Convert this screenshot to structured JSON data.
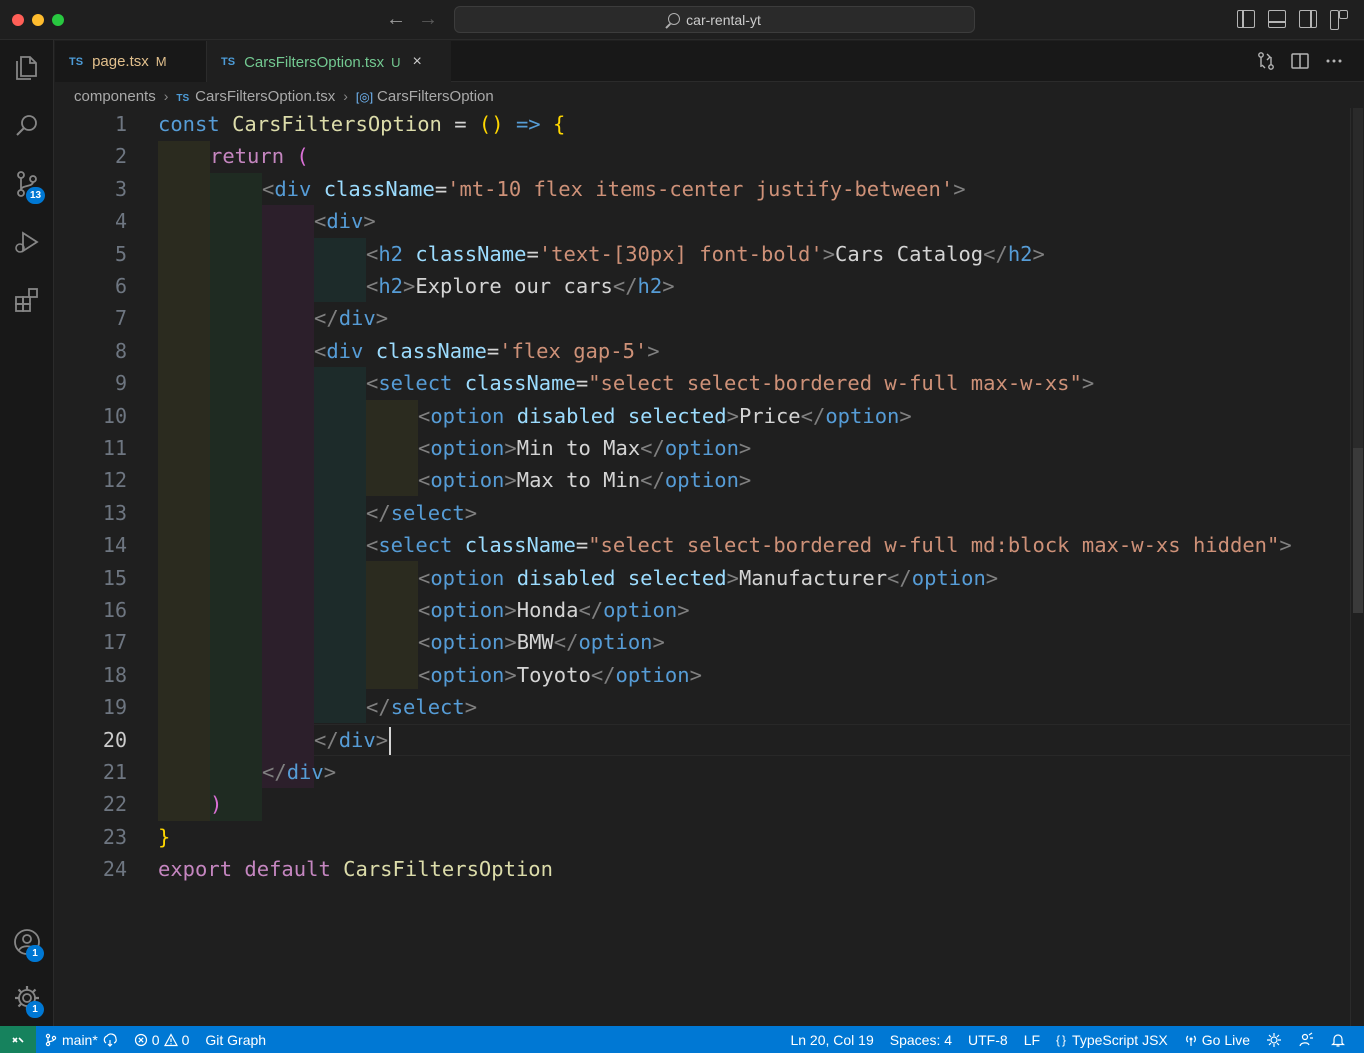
{
  "window": {
    "search_text": "car-rental-yt"
  },
  "activity_bar": {
    "source_control_badge": "13",
    "accounts_badge": "1",
    "manage_badge": "1"
  },
  "tabs": [
    {
      "type_label": "TS",
      "name": "page.tsx",
      "flag": "M"
    },
    {
      "type_label": "TS",
      "name": "CarsFiltersOption.tsx",
      "flag": "U",
      "close": "×"
    }
  ],
  "breadcrumbs": {
    "folder": "components",
    "file_type": "TS",
    "file": "CarsFiltersOption.tsx",
    "symbol": "CarsFiltersOption"
  },
  "editor": {
    "active_line": 20,
    "line_numbers": [
      "1",
      "2",
      "3",
      "4",
      "5",
      "6",
      "7",
      "8",
      "9",
      "10",
      "11",
      "12",
      "13",
      "14",
      "15",
      "16",
      "17",
      "18",
      "19",
      "20",
      "21",
      "22",
      "23",
      "24"
    ]
  },
  "code": {
    "l1": [
      "const",
      " ",
      "CarsFiltersOption",
      " ",
      "=",
      " ",
      "()",
      " ",
      "=>",
      " ",
      "{"
    ],
    "l2": [
      "return",
      " ",
      "("
    ],
    "l3": [
      "<",
      "div",
      " ",
      "className",
      "=",
      "'mt-10 flex items-center justify-between'",
      ">"
    ],
    "l4": [
      "<",
      "div",
      ">"
    ],
    "l5": [
      "<",
      "h2",
      " ",
      "className",
      "=",
      "'text-[30px] font-bold'",
      ">",
      "Cars Catalog",
      "</",
      "h2",
      ">"
    ],
    "l6": [
      "<",
      "h2",
      ">",
      "Explore our cars",
      "</",
      "h2",
      ">"
    ],
    "l7": [
      "</",
      "div",
      ">"
    ],
    "l8": [
      "<",
      "div",
      " ",
      "className",
      "=",
      "'flex gap-5'",
      ">"
    ],
    "l9": [
      "<",
      "select",
      " ",
      "className",
      "=",
      "\"select select-bordered w-full max-w-xs\"",
      ">"
    ],
    "l10": [
      "<",
      "option",
      " ",
      "disabled",
      " ",
      "selected",
      ">",
      "Price",
      "</",
      "option",
      ">"
    ],
    "l11": [
      "<",
      "option",
      ">",
      "Min to Max",
      "</",
      "option",
      ">"
    ],
    "l12": [
      "<",
      "option",
      ">",
      "Max to Min",
      "</",
      "option",
      ">"
    ],
    "l13": [
      "</",
      "select",
      ">"
    ],
    "l14": [
      "<",
      "select",
      " ",
      "className",
      "=",
      "\"select select-bordered w-full md:block max-w-xs hidden\"",
      ">"
    ],
    "l15": [
      "<",
      "option",
      " ",
      "disabled",
      " ",
      "selected",
      ">",
      "Manufacturer",
      "</",
      "option",
      ">"
    ],
    "l16": [
      "<",
      "option",
      ">",
      "Honda",
      "</",
      "option",
      ">"
    ],
    "l17": [
      "<",
      "option",
      ">",
      "BMW",
      "</",
      "option",
      ">"
    ],
    "l18": [
      "<",
      "option",
      ">",
      "Toyoto",
      "</",
      "option",
      ">"
    ],
    "l19": [
      "</",
      "select",
      ">"
    ],
    "l20": [
      "</",
      "div",
      ">"
    ],
    "l21": [
      "</",
      "div",
      ">"
    ],
    "l22": [
      ")"
    ],
    "l23": [
      "}"
    ],
    "l24": [
      "export",
      " ",
      "default",
      " ",
      "CarsFiltersOption"
    ]
  },
  "status_bar": {
    "branch": "main*",
    "errors": "0",
    "warnings": "0",
    "git_graph": "Git Graph",
    "cursor": "Ln 20, Col 19",
    "spaces": "Spaces: 4",
    "encoding": "UTF-8",
    "eol": "LF",
    "language_braces": "{}",
    "language": "TypeScript JSX",
    "go_live": "Go Live"
  },
  "colors": {
    "accent": "#0078d4",
    "remote": "#16825d",
    "editor_bg": "#1f1f1f",
    "guide_yellow": "#2c2c1f",
    "guide_green": "#1f2b22",
    "guide_purple": "#2c1f2c",
    "guide_teal": "#1e2b2b"
  },
  "icons": [
    "explorer-icon",
    "search-icon",
    "source-control-icon",
    "run-debug-icon",
    "extensions-icon",
    "accounts-icon",
    "manage-gear-icon",
    "branch-icon",
    "sync-icon",
    "error-icon",
    "warning-icon",
    "broadcast-icon",
    "feedback-icon",
    "bell-icon"
  ]
}
